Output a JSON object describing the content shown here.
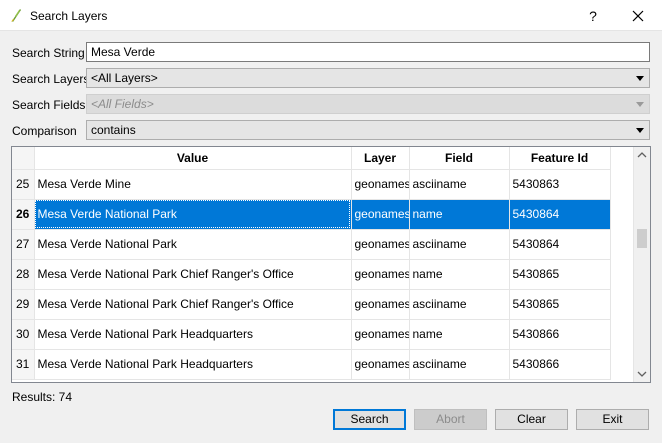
{
  "window": {
    "title": "Search Layers",
    "help_label": "?",
    "accent_color": "#0078d7"
  },
  "form": {
    "search_string_label": "Search String",
    "search_string_value": "Mesa Verde",
    "search_layers_label": "Search Layers",
    "search_layers_value": "<All Layers>",
    "search_fields_label": "Search Fields",
    "search_fields_value": "<All Fields>",
    "comparison_label": "Comparison",
    "comparison_value": "contains"
  },
  "table": {
    "columns": [
      "Value",
      "Layer",
      "Field",
      "Feature Id"
    ],
    "rows": [
      {
        "num": "25",
        "value": "Mesa Verde Mine",
        "layer": "geonames",
        "field": "asciiname",
        "id": "5430863"
      },
      {
        "num": "26",
        "value": "Mesa Verde National Park",
        "layer": "geonames",
        "field": "name",
        "id": "5430864"
      },
      {
        "num": "27",
        "value": "Mesa Verde National Park",
        "layer": "geonames",
        "field": "asciiname",
        "id": "5430864"
      },
      {
        "num": "28",
        "value": "Mesa Verde National Park Chief Ranger's Office",
        "layer": "geonames",
        "field": "name",
        "id": "5430865"
      },
      {
        "num": "29",
        "value": "Mesa Verde National Park Chief Ranger's Office",
        "layer": "geonames",
        "field": "asciiname",
        "id": "5430865"
      },
      {
        "num": "30",
        "value": "Mesa Verde National Park Headquarters",
        "layer": "geonames",
        "field": "name",
        "id": "5430866"
      },
      {
        "num": "31",
        "value": "Mesa Verde National Park Headquarters",
        "layer": "geonames",
        "field": "asciiname",
        "id": "5430866"
      }
    ]
  },
  "status": {
    "results_text": "Results: 74"
  },
  "buttons": {
    "search": "Search",
    "abort": "Abort",
    "clear": "Clear",
    "exit": "Exit"
  }
}
